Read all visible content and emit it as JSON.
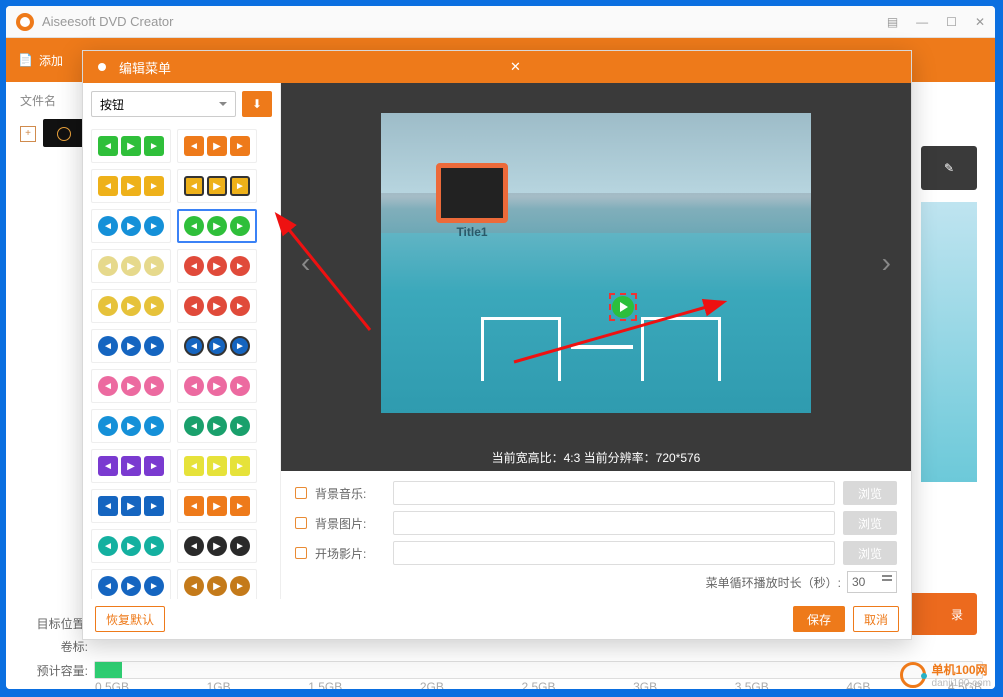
{
  "app_title": "Aiseesoft DVD Creator",
  "toolbar": {
    "add_label": "添加"
  },
  "left": {
    "filename_header": "文件名"
  },
  "bottom": {
    "target_label": "目标位置:",
    "volume_label": "卷标:",
    "capacity_label": "预计容量:",
    "ticks": [
      "0.5GB",
      "1GB",
      "1.5GB",
      "2GB",
      "2.5GB",
      "3GB",
      "3.5GB",
      "4GB",
      "4.5GB"
    ]
  },
  "start_btn": "录",
  "dialog": {
    "title": "编辑菜单",
    "dropdown": "按钮",
    "chip_label": "Title1",
    "info_bar": "当前宽高比：4:3 当前分辨率：720*576",
    "bg_music": "背景音乐:",
    "bg_image": "背景图片:",
    "opening": "开场影片:",
    "browse": "浏览",
    "loop_label": "菜单循环播放时长（秒）:",
    "loop_value": "30",
    "restore": "恢复默认",
    "save": "保存",
    "cancel": "取消"
  },
  "watermark": {
    "brand": "单机100网",
    "sub": "danji100.com"
  }
}
